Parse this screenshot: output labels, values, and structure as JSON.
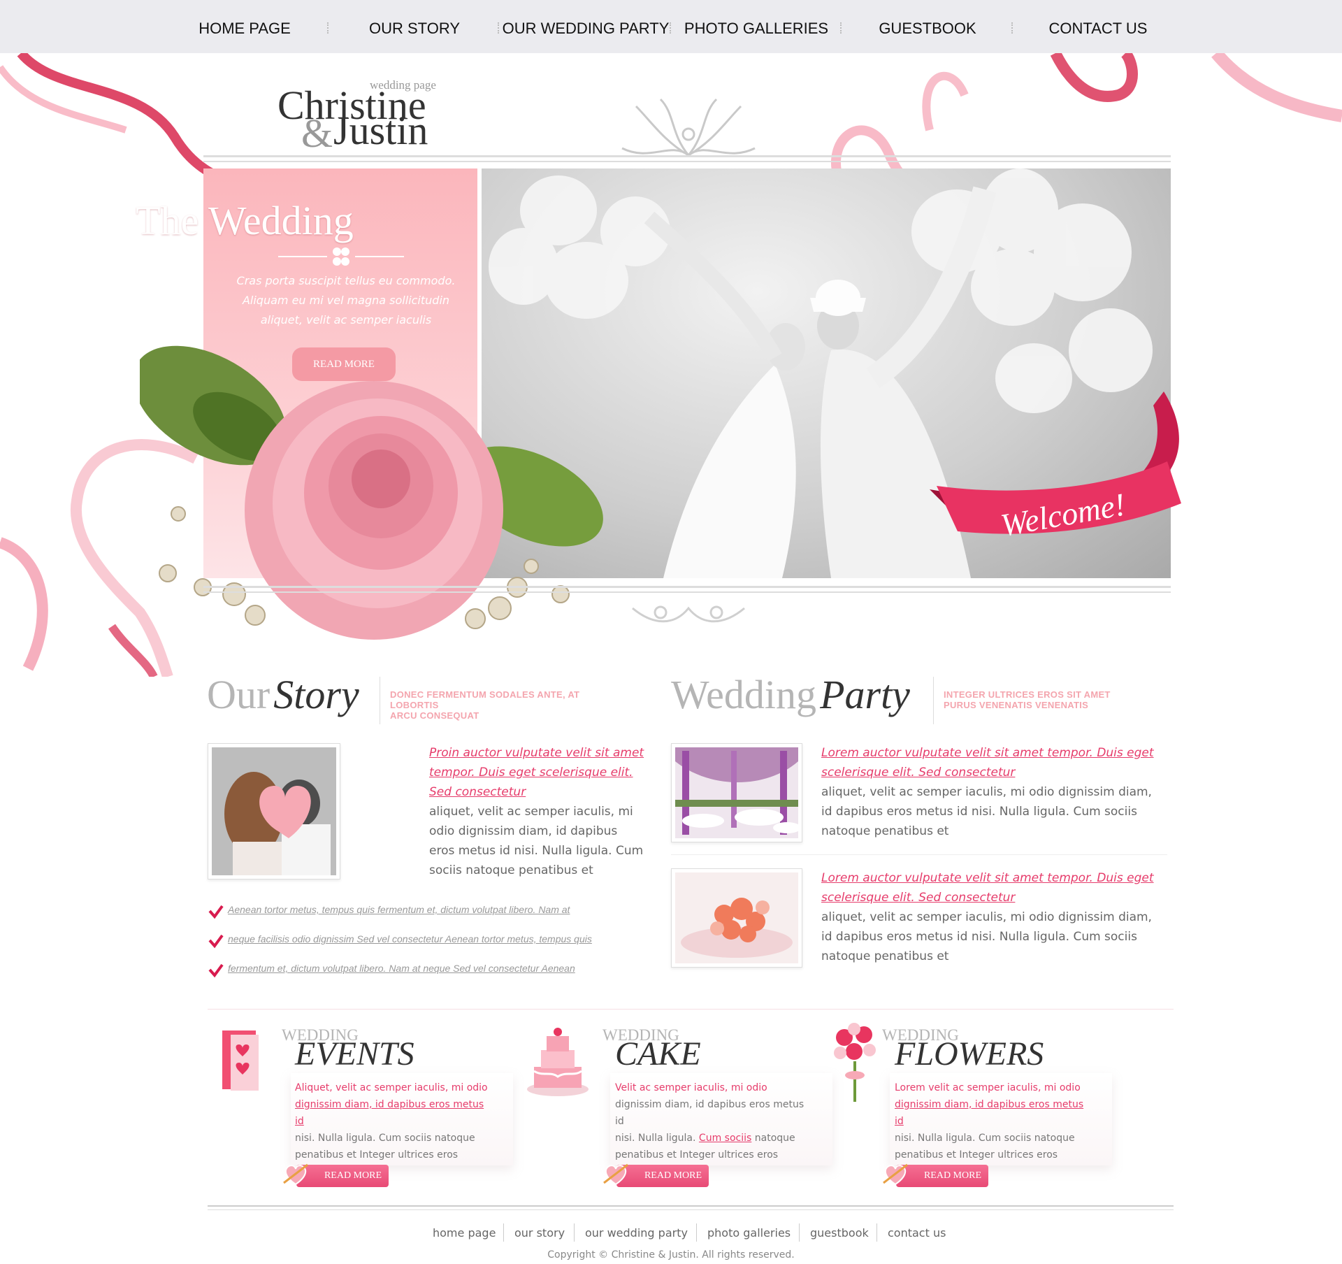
{
  "nav": {
    "items": [
      "HOME PAGE",
      "OUR STORY",
      "OUR WEDDING PARTY",
      "PHOTO GALLERIES",
      "GUESTBOOK",
      "CONTACT US"
    ]
  },
  "logo": {
    "subtitle": "wedding page",
    "name1": "Christine",
    "amp": "&",
    "name2": "Justin"
  },
  "hero": {
    "title": "The Wedding",
    "text": "Cras porta suscipit tellus eu commodo. Aliquam eu mi vel magna sollicitudin aliquet, velit ac semper iaculis",
    "button": "READ MORE",
    "ribbon": "Welcome!"
  },
  "story": {
    "title_grey": "Our",
    "title_dark": "Story",
    "tagline_1": "DONEC FERMENTUM SODALES ANTE, AT LOBORTIS",
    "tagline_2": "ARCU CONSEQUAT",
    "link": "Proin auctor vulputate velit sit amet tempor. Duis eget scelerisque elit. Sed consectetur",
    "text": "aliquet, velit ac semper iaculis, mi odio dignissim diam, id dapibus eros metus id nisi. Nulla ligula. Cum sociis natoque penatibus et",
    "checks": [
      "Aenean tortor metus, tempus quis fermentum et, dictum volutpat libero. Nam at",
      "neque facilisis odio dignissim Sed vel consectetur Aenean tortor metus, tempus quis",
      "fermentum et, dictum volutpat libero. Nam at neque Sed vel consectetur Aenean"
    ]
  },
  "party": {
    "title_grey": "Wedding",
    "title_dark": "Party",
    "tagline_1": "INTEGER ULTRICES EROS SIT AMET",
    "tagline_2": "PURUS VENENATIS VENENATIS",
    "items": [
      {
        "link": "Lorem auctor vulputate velit sit amet tempor. Duis eget scelerisque elit. Sed consectetur",
        "text": "aliquet, velit ac semper iaculis, mi odio dignissim diam, id dapibus eros metus id nisi. Nulla ligula. Cum sociis natoque penatibus et"
      },
      {
        "link": "Lorem auctor vulputate velit sit amet tempor. Duis eget scelerisque elit. Sed consectetur",
        "text": "aliquet, velit ac semper iaculis, mi odio dignissim diam, id dapibus eros metus id nisi. Nulla ligula. Cum sociis natoque penatibus et"
      }
    ]
  },
  "blocks": [
    {
      "sub": "WEDDING",
      "title": "EVENTS",
      "p1": "Aliquet, velit ac semper iaculis, mi odio",
      "p2": "dignissim diam, id dapibus eros metus id",
      "p3": "nisi. Nulla ligula. Cum sociis natoque",
      "p4": "penatibus et Integer ultrices eros",
      "button": "READ MORE"
    },
    {
      "sub": "WEDDING",
      "title": "CAKE",
      "p1": "Velit ac semper iaculis, mi odio",
      "p2": "dignissim diam, id dapibus eros metus id",
      "p3a": "nisi. Nulla ligula. ",
      "p3b": "Cum sociis",
      "p3c": " natoque",
      "p4": "penatibus et Integer ultrices eros",
      "button": "READ MORE"
    },
    {
      "sub": "WEDDING",
      "title": "FLOWERS",
      "p1": "Lorem velit ac semper iaculis, mi odio",
      "p2": "dignissim diam, id dapibus eros metus id",
      "p3": "nisi. Nulla ligula. Cum sociis natoque",
      "p4": "penatibus et Integer ultrices eros",
      "button": "READ MORE"
    }
  ],
  "footer": {
    "links": [
      "home page",
      "our story",
      "our wedding party",
      "photo galleries",
      "guestbook",
      "contact us"
    ],
    "copyright": "Copyright © Christine & Justin. All rights reserved."
  },
  "colors": {
    "accent": "#e63c6b",
    "panel_pink": "#fbb6bc",
    "nav_bg": "#ebebef"
  }
}
